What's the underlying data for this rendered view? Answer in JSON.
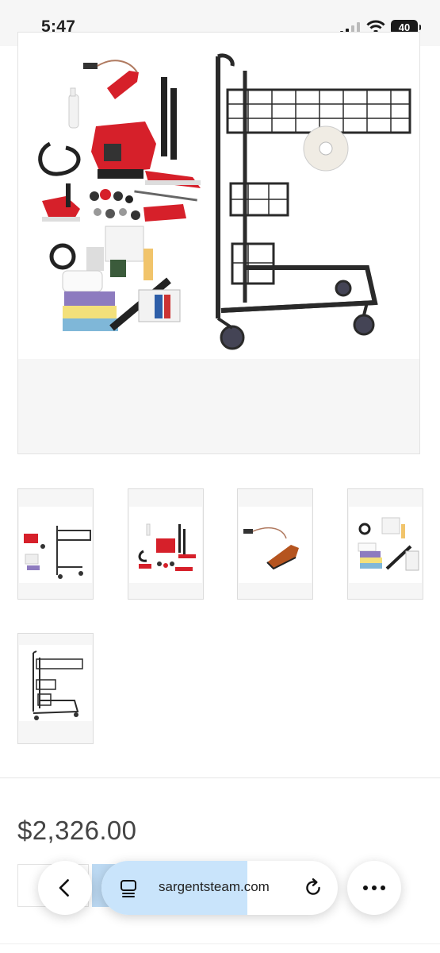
{
  "status_bar": {
    "time": "5:47",
    "battery": "40"
  },
  "gallery": {
    "main_image": "steamer-kit-with-cart",
    "thumbnails": [
      "steamer-kit-with-cart",
      "steamer-and-attachments",
      "steam-iron",
      "accessories-and-cloths",
      "utility-cart"
    ]
  },
  "product": {
    "price": "$2,326.00"
  },
  "browser": {
    "url": "sargentsteam.com"
  },
  "colors": {
    "accent": "#c9e4fb",
    "product_red": "#d6202a"
  }
}
